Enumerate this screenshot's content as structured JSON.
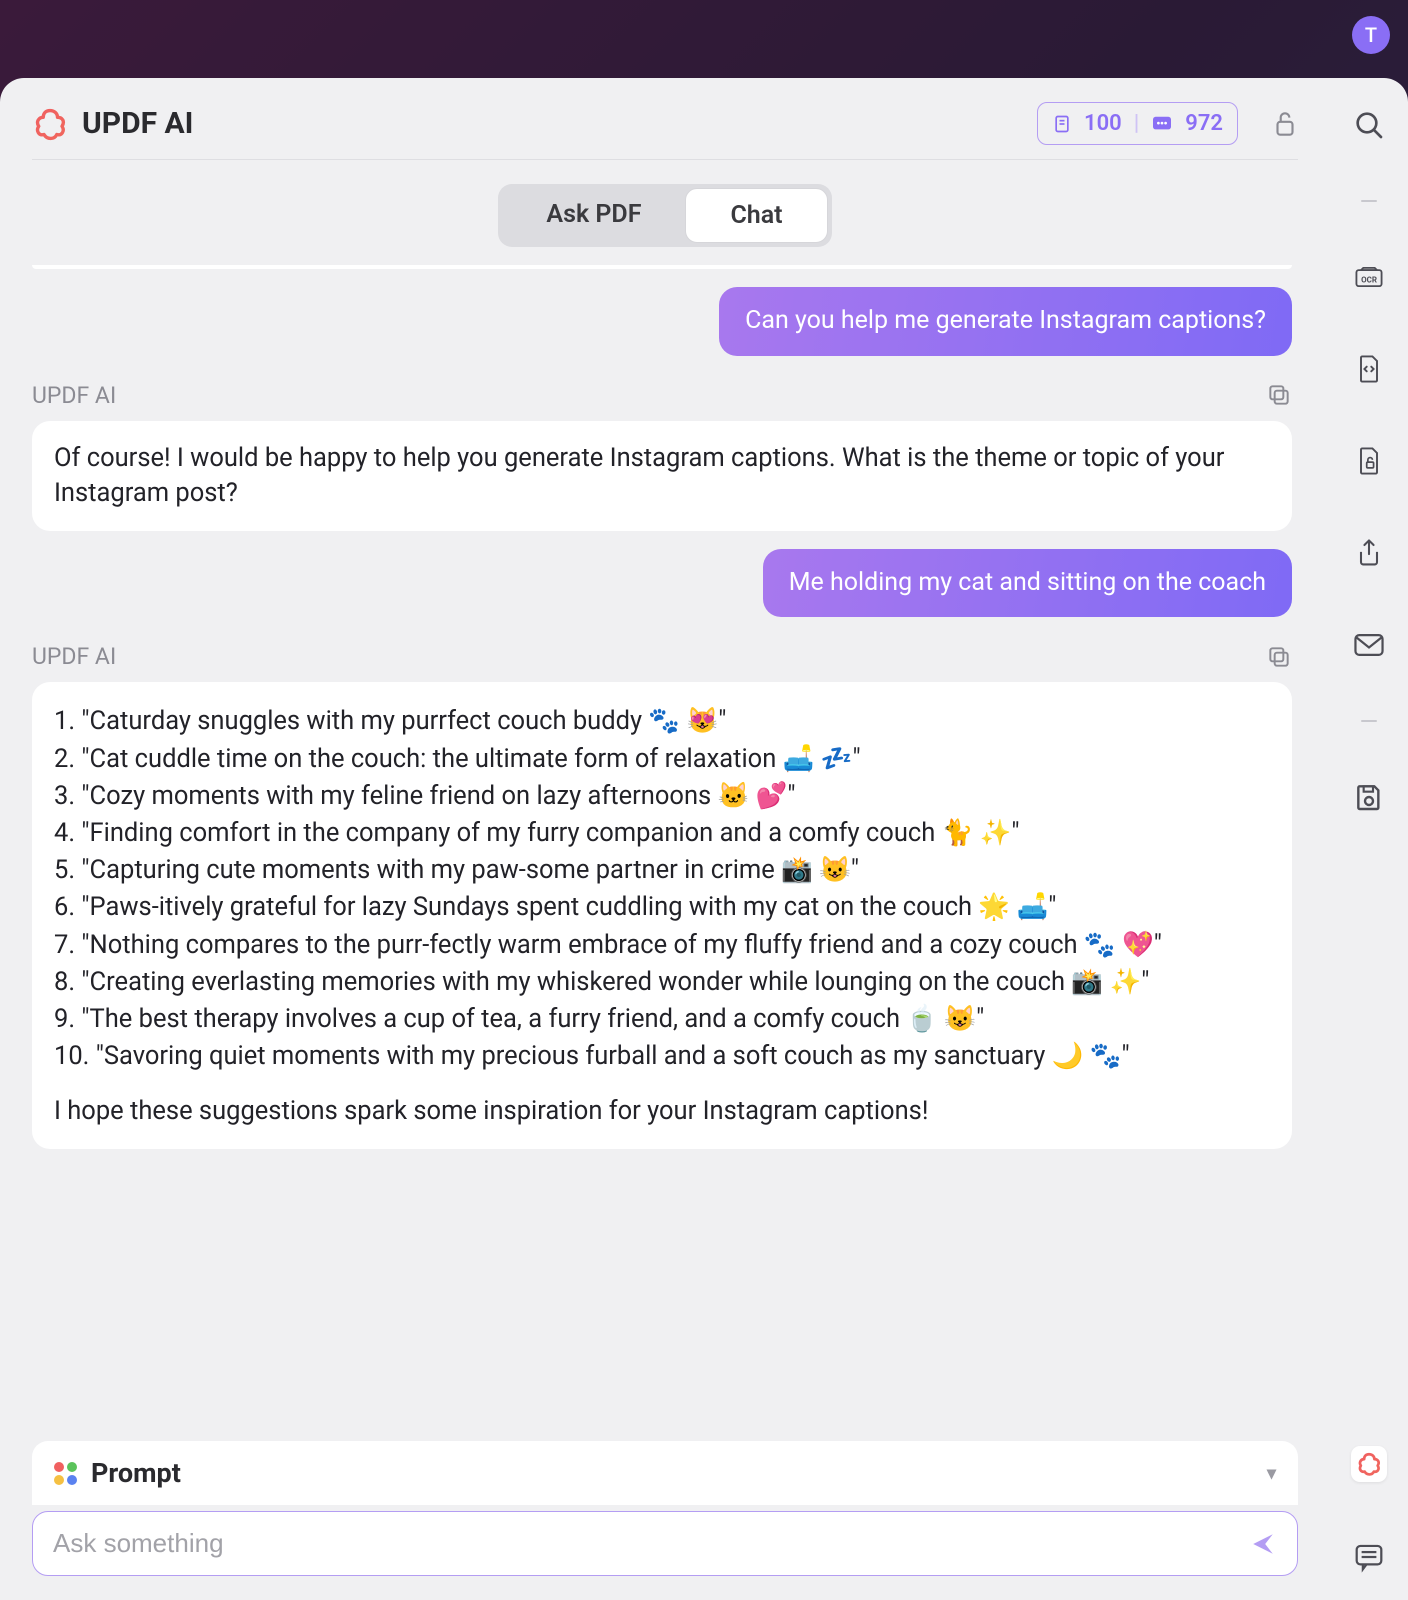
{
  "avatar_letter": "T",
  "header": {
    "title": "UPDF AI",
    "count_pages": "100",
    "count_tokens": "972"
  },
  "tabs": {
    "ask_pdf": "Ask PDF",
    "chat": "Chat"
  },
  "chat": {
    "user1": "Can you help me generate Instagram captions?",
    "ai_label": "UPDF AI",
    "ai1": "Of course! I would be happy to help you generate Instagram captions. What is the theme or topic of your Instagram post?",
    "user2": "Me holding my cat and sitting on the coach",
    "ai2": {
      "items": [
        "1. \"Caturday snuggles with my purrfect couch buddy 🐾 😻\"",
        "2. \"Cat cuddle time on the couch: the ultimate form of relaxation 🛋️ 💤\"",
        "3. \"Cozy moments with my feline friend on lazy afternoons 🐱 💕\"",
        "4. \"Finding comfort in the company of my furry companion and a comfy couch 🐈 ✨\"",
        "5. \"Capturing cute moments with my paw-some partner in crime 📸 😺\"",
        "6. \"Paws-itively grateful for lazy Sundays spent cuddling with my cat on the couch 🌟 🛋️\"",
        "7. \"Nothing compares to the purr-fectly warm embrace of my fluffy friend and a cozy couch 🐾 💖\"",
        "8. \"Creating everlasting memories with my whiskered wonder while lounging on the couch 📸 ✨\"",
        "9. \"The best therapy involves a cup of tea, a furry friend, and a comfy couch 🍵 😺\"",
        "10. \"Savoring quiet moments with my precious furball and a soft couch as my sanctuary 🌙 🐾\""
      ],
      "footer": "I hope these suggestions spark some inspiration for your Instagram captions!"
    }
  },
  "prompt": {
    "label": "Prompt",
    "placeholder": "Ask something"
  }
}
